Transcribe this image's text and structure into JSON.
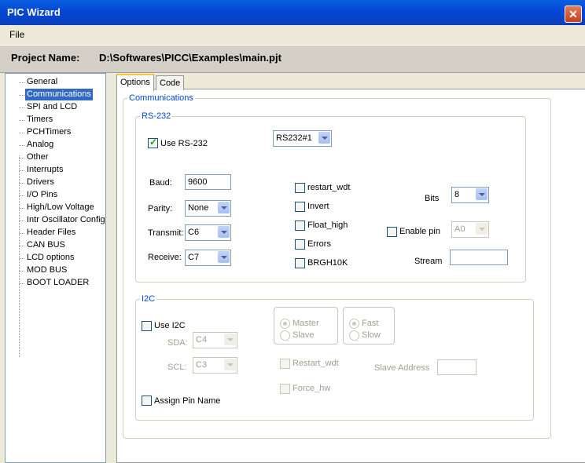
{
  "window": {
    "title": "PIC Wizard",
    "close_label": "✕"
  },
  "menu": {
    "file": "File"
  },
  "project": {
    "label": "Project Name:",
    "path": "D:\\Softwares\\PICC\\Examples\\main.pjt"
  },
  "sidebar": {
    "items": [
      {
        "label": "General"
      },
      {
        "label": "Communications",
        "selected": true
      },
      {
        "label": "SPI and LCD"
      },
      {
        "label": "Timers"
      },
      {
        "label": "PCHTimers"
      },
      {
        "label": "Analog"
      },
      {
        "label": "Other"
      },
      {
        "label": "Interrupts"
      },
      {
        "label": "Drivers"
      },
      {
        "label": "I/O Pins"
      },
      {
        "label": "High/Low Voltage"
      },
      {
        "label": "Intr Oscillator Config"
      },
      {
        "label": "Header Files"
      },
      {
        "label": "CAN BUS"
      },
      {
        "label": "LCD options"
      },
      {
        "label": "MOD BUS"
      },
      {
        "label": "BOOT LOADER"
      }
    ]
  },
  "tabs": {
    "options": "Options",
    "code": "Code"
  },
  "comm": {
    "group_label": "Communications",
    "rs232": {
      "label": "RS-232",
      "use_label": "Use RS-232",
      "use_checked": true,
      "port_value": "RS232#1",
      "baud_label": "Baud:",
      "baud_value": "9600",
      "parity_label": "Parity:",
      "parity_value": "None",
      "transmit_label": "Transmit:",
      "transmit_value": "C6",
      "receive_label": "Receive:",
      "receive_value": "C7",
      "restart_wdt": "restart_wdt",
      "invert": "Invert",
      "float_high": "Float_high",
      "errors": "Errors",
      "brgh10k": "BRGH10K",
      "bits_label": "Bits",
      "bits_value": "8",
      "enable_pin_label": "Enable pin",
      "enable_pin_value": "A0",
      "stream_label": "Stream",
      "stream_value": ""
    },
    "i2c": {
      "label": "I2C",
      "use_label": "Use I2C",
      "sda_label": "SDA:",
      "sda_value": "C4",
      "scl_label": "SCL:",
      "scl_value": "C3",
      "master": "Master",
      "slave": "Slave",
      "fast": "Fast",
      "slow": "Slow",
      "restart_wdt": "Restart_wdt",
      "force_hw": "Force_hw",
      "slave_address_label": "Slave Address",
      "slave_address_value": ""
    },
    "assign_pin_name": "Assign Pin Name"
  }
}
